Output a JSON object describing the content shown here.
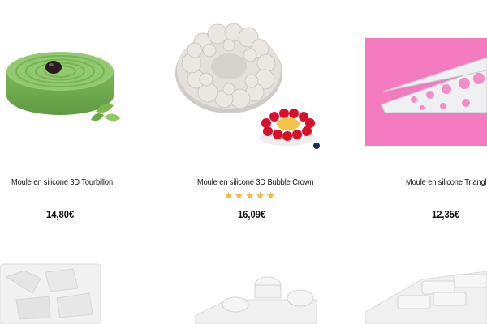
{
  "products": [
    {
      "name": "Moule en silicone 3D Tourbillon",
      "price": "14,80€",
      "rating_stars": 0
    },
    {
      "name": "Moule en silicone 3D Bubble Crown",
      "price": "16,09€",
      "rating_stars": 5
    },
    {
      "name": "Moule en silicone Triangle",
      "price": "12,35€",
      "rating_stars": 0
    }
  ],
  "colors": {
    "star": "#f5b942",
    "tourbillon_green": "#8cc56a",
    "triangle_pink": "#f47bc0"
  },
  "icons": [
    "star-icon"
  ]
}
